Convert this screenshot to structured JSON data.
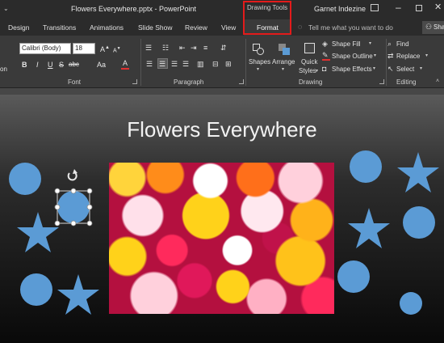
{
  "window": {
    "title": "Flowers Everywhere.pptx - PowerPoint",
    "contextual_tab_group": "Drawing Tools",
    "user": "Garnet Indezine",
    "share": "Sha"
  },
  "tabs": [
    "Design",
    "Transitions",
    "Animations",
    "Slide Show",
    "Review",
    "View"
  ],
  "active_tab": "Format",
  "tell_me": "Tell me what you want to do",
  "ribbon": {
    "clipboard_fragment": "on",
    "font": {
      "name": "Calibri (Body)",
      "size": "18",
      "group_label": "Font",
      "bold": "B",
      "italic": "I",
      "underline": "U",
      "strike": "S",
      "char_spacing": "abc",
      "case": "Aa",
      "color": "A",
      "grow": "A",
      "shrink": "A"
    },
    "paragraph": {
      "group_label": "Paragraph"
    },
    "drawing": {
      "group_label": "Drawing",
      "shapes": "Shapes",
      "arrange": "Arrange",
      "quick_styles_1": "Quick",
      "quick_styles_2": "Styles",
      "shape_fill": "Shape Fill",
      "shape_outline": "Shape Outline",
      "shape_effects": "Shape Effects"
    },
    "editing": {
      "group_label": "Editing",
      "find": "Find",
      "replace": "Replace",
      "select": "Select"
    }
  },
  "slide": {
    "title": "Flowers Everywhere",
    "shape_color": "#5b9bd5"
  },
  "colors": {
    "highlight_box": "#e31b1b",
    "font_color_bar": "#e03030",
    "outline_bar": "#e03030"
  }
}
